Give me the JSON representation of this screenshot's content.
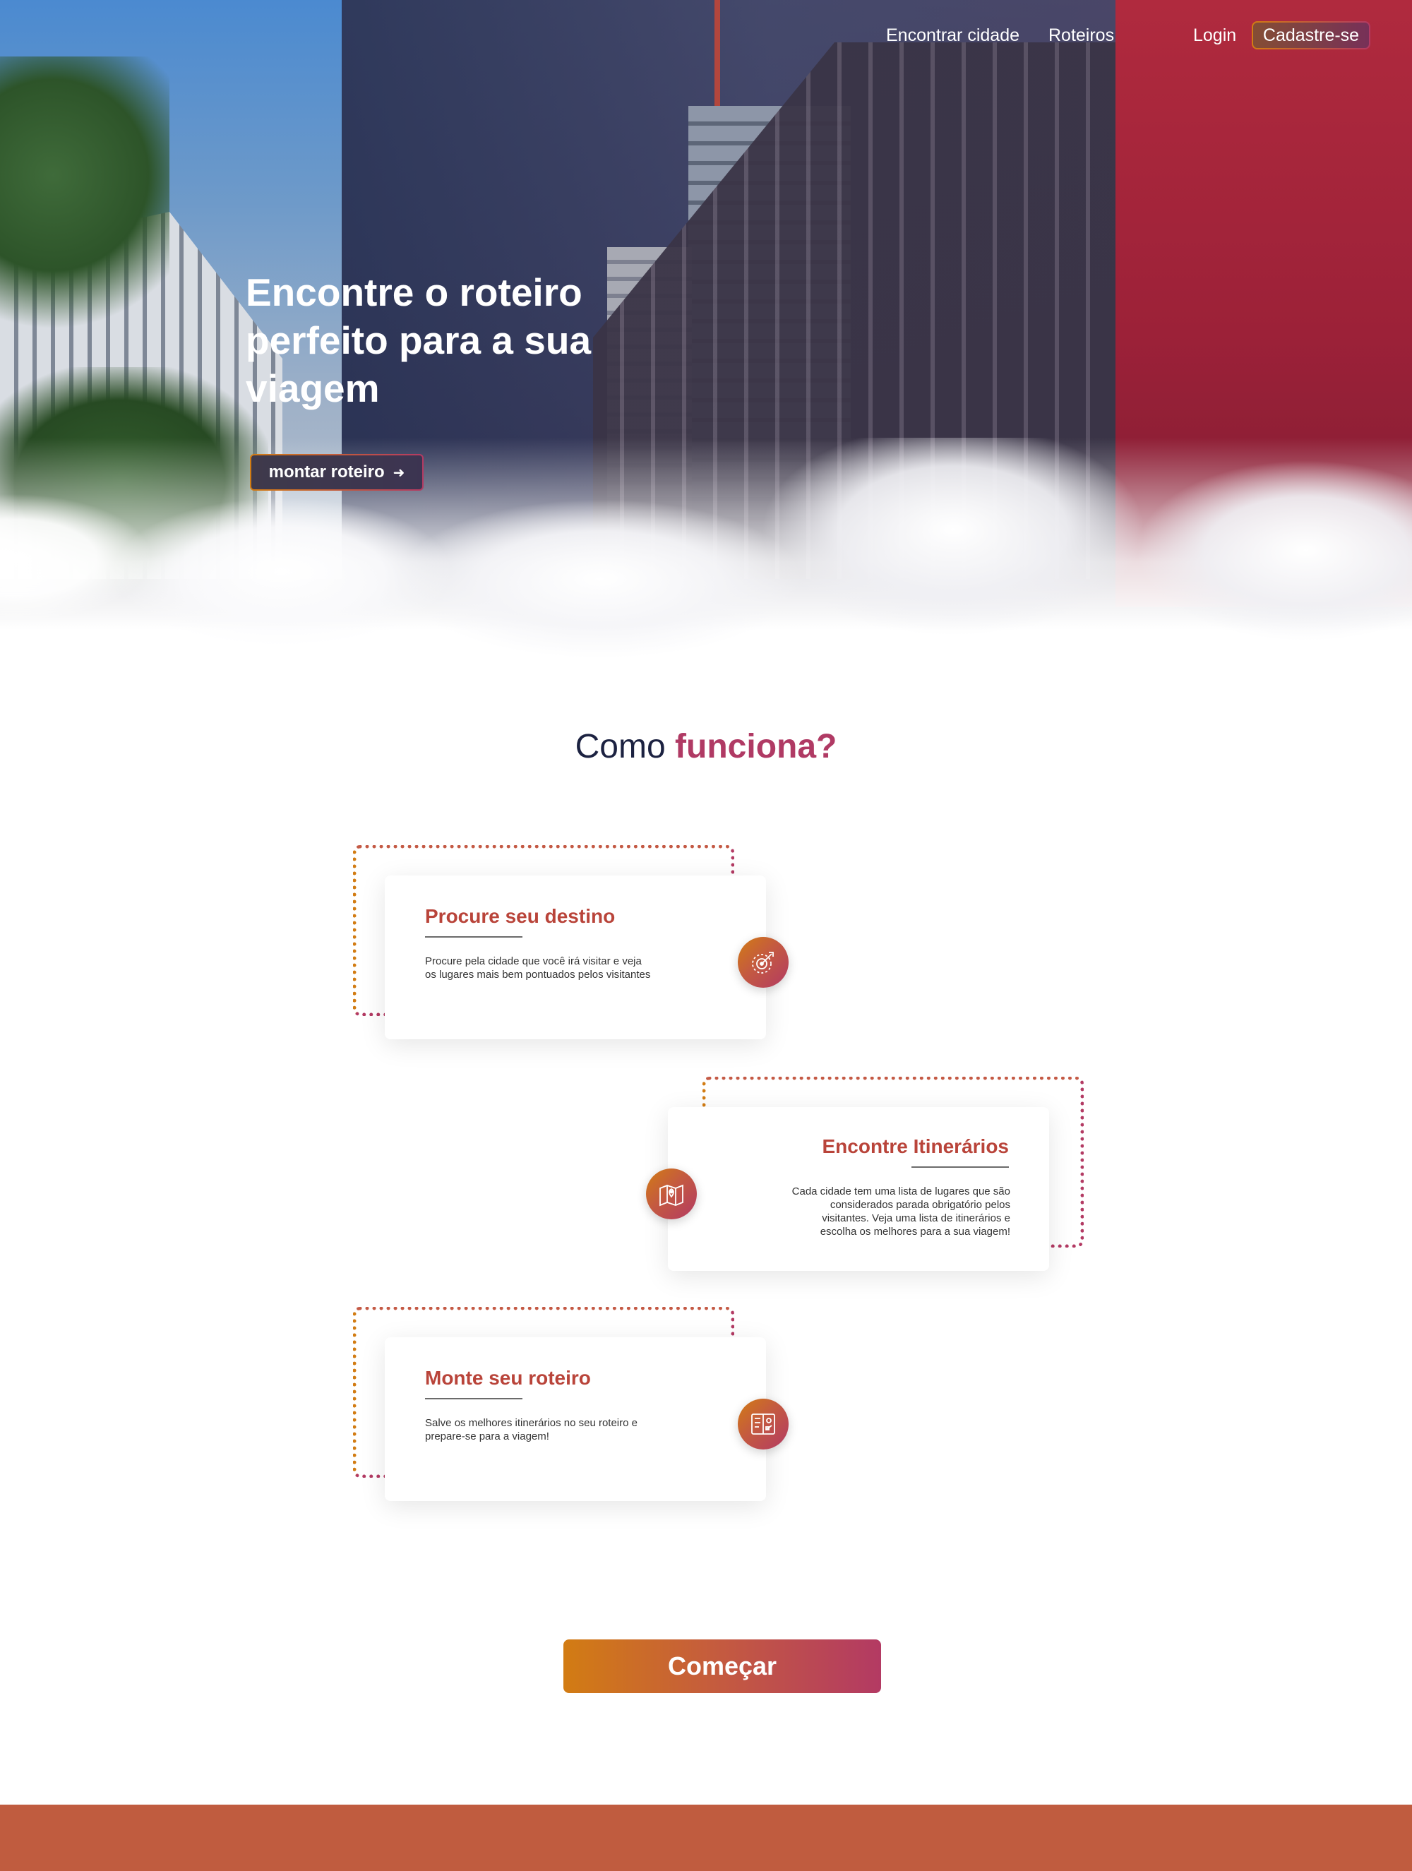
{
  "nav": {
    "find_city": "Encontrar cidade",
    "itineraries": "Roteiros",
    "login": "Login",
    "signup": "Cadastre-se"
  },
  "hero": {
    "title": "Encontre o roteiro perfeito para a sua viagem",
    "button_label": "montar  roteiro",
    "button_icon": "arrow-right-icon"
  },
  "how_it_works": {
    "title_plain": "Como",
    "title_accent": "funciona?",
    "steps": [
      {
        "title": "Procure seu destino",
        "text": "Procure pela cidade que você irá visitar e veja os lugares mais bem pontuados pelos visitantes",
        "icon": "compass-target-icon"
      },
      {
        "title": "Encontre Itinerários",
        "text": "Cada cidade tem uma lista de lugares que são considerados parada obrigatório pelos visitantes.  Veja uma lista de itinerários e escolha os melhores para a sua viagem!",
        "icon": "map-pin-icon"
      },
      {
        "title": "Monte seu roteiro",
        "text": "Salve os melhores itinerários no seu roteiro e prepare-se para a viagem!",
        "icon": "itinerary-map-icon"
      }
    ]
  },
  "cta": {
    "label": "Começar"
  },
  "colors": {
    "accent_orange": "#d27c13",
    "accent_magenta": "#b33a63",
    "heading_red": "#b9443a",
    "navy": "#1c2241",
    "footer": "#c05c3f"
  }
}
